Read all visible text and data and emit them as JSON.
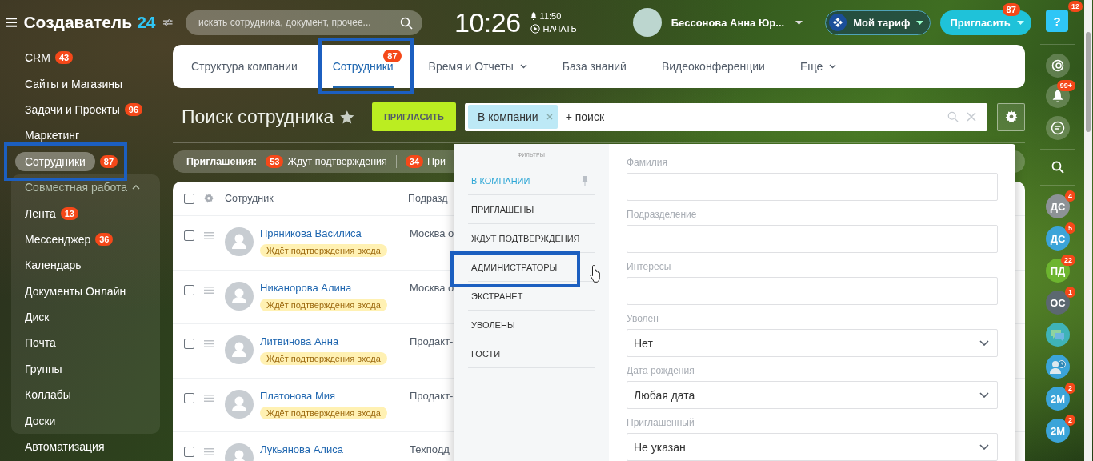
{
  "header": {
    "logo_name": "Создаватель",
    "logo_number": "24",
    "search_placeholder": "искать сотрудника, документ, прочее...",
    "clock": "10:26",
    "alarm_time": "11:50",
    "start_label": "НАЧАТЬ",
    "user_name": "Бессонова Анна Юр...",
    "tariff_button": "Мой тариф",
    "invite_button": {
      "label": "Пригласить",
      "badge": "87"
    }
  },
  "sidebar": {
    "items": [
      {
        "kind": "link",
        "label": "CRM",
        "badge": "43",
        "selected": false
      },
      {
        "kind": "link",
        "label": "Сайты и Магазины",
        "selected": false
      },
      {
        "kind": "link",
        "label": "Задачи и Проекты",
        "badge": "96",
        "selected": false
      },
      {
        "kind": "link",
        "label": "Маркетинг",
        "selected": false
      },
      {
        "kind": "link",
        "label": "Сотрудники",
        "badge": "87",
        "selected": true,
        "highlighted": true
      },
      {
        "kind": "group",
        "label": "Совместная работа",
        "expanded": true,
        "children": [
          {
            "label": "Лента",
            "badge": "13"
          },
          {
            "label": "Мессенджер",
            "badge": "36"
          },
          {
            "label": "Календарь"
          },
          {
            "label": "Документы Онлайн"
          },
          {
            "label": "Диск"
          },
          {
            "label": "Почта"
          },
          {
            "label": "Группы"
          },
          {
            "label": "Коллабы"
          },
          {
            "label": "Доски"
          }
        ]
      },
      {
        "kind": "link",
        "label": "Автоматизация",
        "selected": false
      }
    ]
  },
  "tabs": [
    {
      "label": "Структура компании",
      "selected": false
    },
    {
      "label": "Сотрудники",
      "badge": "87",
      "selected": true,
      "highlighted": true
    },
    {
      "label": "Время и Отчеты",
      "selected": false,
      "has_menu": true
    },
    {
      "label": "База знаний",
      "selected": false
    },
    {
      "label": "Видеоконференции",
      "selected": false
    },
    {
      "label": "Еще",
      "selected": false,
      "has_menu": true
    }
  ],
  "page": {
    "title": "Поиск сотрудника",
    "invite_button": "ПРИГЛАСИТЬ",
    "filter": {
      "chip": "В компании",
      "add_search": "+ поиск"
    }
  },
  "invitations": {
    "label": "Приглашения:",
    "groups": [
      {
        "count": "53",
        "label": "Ждут подтверждения"
      },
      {
        "count": "34",
        "label": "При"
      }
    ]
  },
  "table": {
    "header_checked": false,
    "columns": [
      "Сотрудник",
      "Подразд"
    ],
    "rows": [
      {
        "name": "Пряникова Василиса",
        "status": "Ждёт подтверждения входа",
        "department": "Москва о",
        "checked": false
      },
      {
        "name": "Никанорова Алина",
        "status": "Ждёт подтверждения входа",
        "department": "Москва о",
        "checked": false
      },
      {
        "name": "Литвинова Анна",
        "status": "Ждёт подтверждения входа",
        "department": "Продакт-",
        "checked": false
      },
      {
        "name": "Платонова Мия",
        "status": "Ждёт подтверждения входа",
        "department": "Продакт-",
        "checked": false
      },
      {
        "name": "Лукьянова Алиса",
        "department": "Техподд",
        "checked": false
      }
    ]
  },
  "filter_menu": {
    "heading": "ФИЛЬТРЫ",
    "presets": [
      {
        "label": "В КОМПАНИИ",
        "selected": true,
        "pinned": true
      },
      {
        "label": "ПРИГЛАШЕНЫ",
        "selected": false
      },
      {
        "label": "ЖДУТ ПОДТВЕРЖДЕНИЯ",
        "selected": false
      },
      {
        "label": "АДМИНИСТРАТОРЫ",
        "selected": false,
        "highlighted": true
      },
      {
        "label": "ЭКСТРАНЕТ",
        "selected": false
      },
      {
        "label": "УВОЛЕНЫ",
        "selected": false
      },
      {
        "label": "ГОСТИ",
        "selected": false
      }
    ],
    "fields": [
      {
        "label": "Фамилия",
        "kind": "text"
      },
      {
        "label": "Подразделение",
        "kind": "text"
      },
      {
        "label": "Интересы",
        "kind": "text"
      },
      {
        "label": "Уволен",
        "kind": "select",
        "value": "Нет"
      },
      {
        "label": "Дата рождения",
        "kind": "select",
        "value": "Любая дата"
      },
      {
        "label": "Приглашенный",
        "kind": "select",
        "value": "Не указан"
      }
    ]
  },
  "rail": {
    "help_label": "?",
    "help_badge": "12",
    "notifications_badge": "99+",
    "contacts": [
      {
        "kind": "initials",
        "initials": "ДС",
        "badge": "4",
        "color": "#8d9296"
      },
      {
        "kind": "initials",
        "initials": "ДС",
        "badge": "5",
        "color": "#3ba4d9"
      },
      {
        "kind": "initials",
        "initials": "ПД",
        "badge": "22",
        "color": "#6db52f"
      },
      {
        "kind": "initials",
        "initials": "ОС",
        "badge": "1",
        "color": "#5c6870"
      },
      {
        "kind": "chat",
        "color": "#3fb3b8"
      },
      {
        "kind": "person-clock",
        "color": "#3ba4d9"
      },
      {
        "kind": "initials",
        "initials": "2М",
        "badge": "2",
        "color": "#3ba4d9"
      },
      {
        "kind": "initials",
        "initials": "2М",
        "badge": "2",
        "color": "#3ba4d9"
      }
    ]
  }
}
